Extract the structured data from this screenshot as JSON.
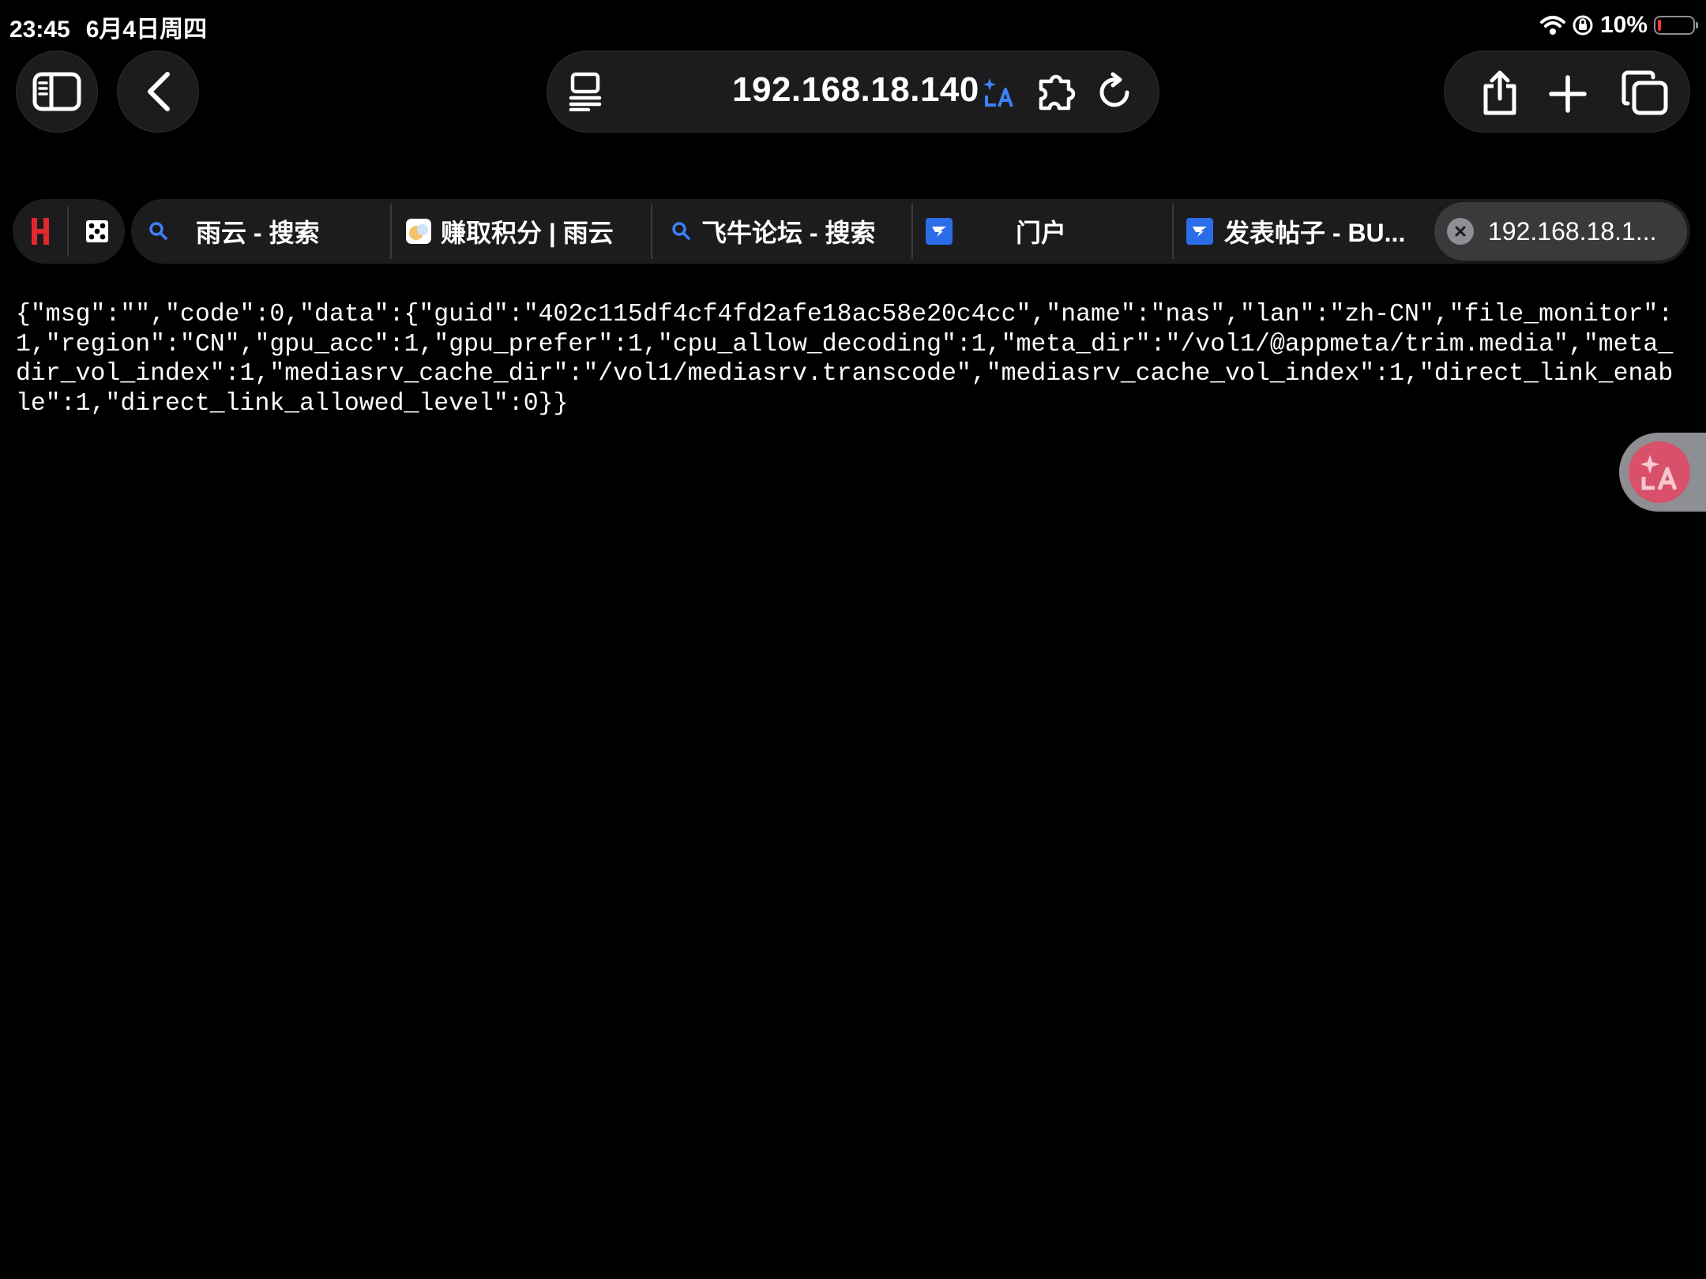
{
  "status_bar": {
    "time": "23:45",
    "date": "6月4日周四",
    "battery_text": "10%",
    "battery_level": 0.1
  },
  "toolbar": {
    "url": "192.168.18.140"
  },
  "tabs": [
    {
      "title": "雨云 - 搜索",
      "icon": "search-icon"
    },
    {
      "title": "赚取积分 | 雨云",
      "icon": "rainyun-favicon"
    },
    {
      "title": "飞牛论坛 - 搜索",
      "icon": "search-icon"
    },
    {
      "title": "门户",
      "icon": "fnnas-favicon"
    },
    {
      "title": "发表帖子 - BU...",
      "icon": "fnnas-favicon"
    },
    {
      "title": "192.168.18.1...",
      "icon": "close-icon",
      "active": true
    }
  ],
  "page": {
    "json_text": "{\"msg\":\"\",\"code\":0,\"data\":{\"guid\":\"402c115df4cf4fd2afe18ac58e20c4cc\",\"name\":\"nas\",\"lan\":\"zh-CN\",\"file_monitor\":1,\"region\":\"CN\",\"gpu_acc\":1,\"gpu_prefer\":1,\"cpu_allow_decoding\":1,\"meta_dir\":\"/vol1/@appmeta/trim.media\",\"meta_dir_vol_index\":1,\"mediasrv_cache_dir\":\"/vol1/mediasrv.transcode\",\"mediasrv_cache_vol_index\":1,\"direct_link_enable\":1,\"direct_link_allowed_level\":0}}"
  },
  "colors": {
    "background": "#000000",
    "toolbar_bg": "#1c1c1e",
    "active_tab_bg": "#3a3a3c",
    "favicon_blue": "#2b6de8",
    "pinned_h_red": "#e0282e",
    "translate_pink": "#d9506a"
  }
}
